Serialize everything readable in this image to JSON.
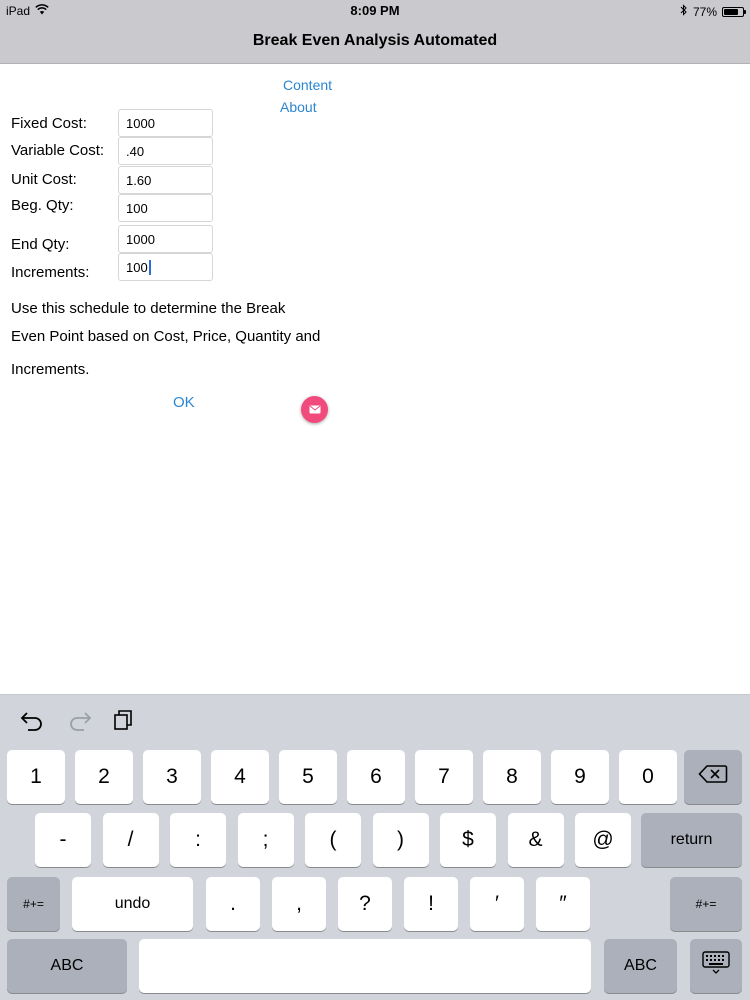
{
  "status": {
    "device": "iPad",
    "time": "8:09 PM",
    "battery": "77%",
    "battery_level": 0.77
  },
  "nav": {
    "title": "Break Even Analysis Automated"
  },
  "links": {
    "content": "Content",
    "about": "About"
  },
  "form": {
    "fixed_cost_label": "Fixed Cost:",
    "fixed_cost_value": "1000",
    "variable_cost_label": "Variable Cost:",
    "variable_cost_value": ".40",
    "unit_cost_label": "Unit Cost:",
    "unit_cost_value": "1.60",
    "beg_qty_label": "Beg. Qty:",
    "beg_qty_value": "100",
    "end_qty_label": "End Qty:",
    "end_qty_value": "1000",
    "increments_label": "Increments:",
    "increments_value": "100"
  },
  "description": {
    "line1": "Use this schedule to determine the Break",
    "line2": "Even Point based on Cost, Price, Quantity and",
    "line3": "Increments."
  },
  "actions": {
    "ok": "OK"
  },
  "keyboard": {
    "row1": [
      "1",
      "2",
      "3",
      "4",
      "5",
      "6",
      "7",
      "8",
      "9",
      "0"
    ],
    "row2": [
      "-",
      "/",
      ":",
      ";",
      "(",
      ")",
      "$",
      "&",
      "@"
    ],
    "return": "return",
    "symbols_left": "#+=",
    "undo": "undo",
    "row3": [
      ".",
      ",",
      "?",
      "!",
      "′",
      "″"
    ],
    "symbols_right": "#+=",
    "abc_left": "ABC",
    "abc_right": "ABC"
  },
  "colors": {
    "accent": "#2b86d0",
    "mail_button": "#f04b7c"
  }
}
